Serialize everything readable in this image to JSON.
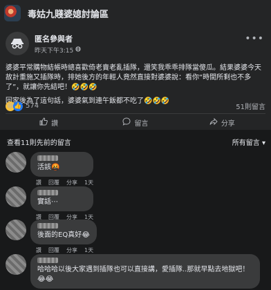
{
  "group": {
    "title": "毒姑九賤婆媳討論區"
  },
  "post": {
    "author": "匿名參與者",
    "time": "昨天下午3:15",
    "paragraphs": [
      "婆婆平常購物結帳時總喜歡倚老賣老亂插隊，還笑我乖乖排隊當傻瓜。結果婆婆今天故計重施又插隊時，排她後方的年輕人竟然直接對婆婆說：看你“時間所剩也不多了”，就讓你先結吧！🤣🤣🤣",
      "回家後為了這句話，婆婆氣到連午飯都不吃了🤣🤣🤣"
    ],
    "reactions": {
      "count": "574",
      "types": [
        "haha",
        "like"
      ]
    },
    "comment_count": "51則留言",
    "actions": [
      {
        "label": "讚",
        "icon": "thumbs-up-icon"
      },
      {
        "label": "留言",
        "icon": "comment-icon"
      },
      {
        "label": "分享",
        "icon": "share-icon"
      }
    ]
  },
  "comments_header": {
    "previous": "查看11則先前的留言",
    "sort": "所有留言"
  },
  "comments": [
    {
      "text": "活該🤬",
      "actions": [
        "讚",
        "回覆",
        "分享"
      ],
      "time": "1天"
    },
    {
      "text": "實話⋯",
      "actions": [
        "讚",
        "回覆",
        "分享"
      ],
      "time": "1天"
    },
    {
      "text": "後面的EQ真好😂",
      "actions": [
        "讚",
        "回覆",
        "分享"
      ],
      "time": "1天"
    },
    {
      "text": "哈哈哈以後大家遇到插隊也可以直接講，愛插隊..那就早點去地獄吧！😂😂",
      "actions": [],
      "time": ""
    }
  ]
}
